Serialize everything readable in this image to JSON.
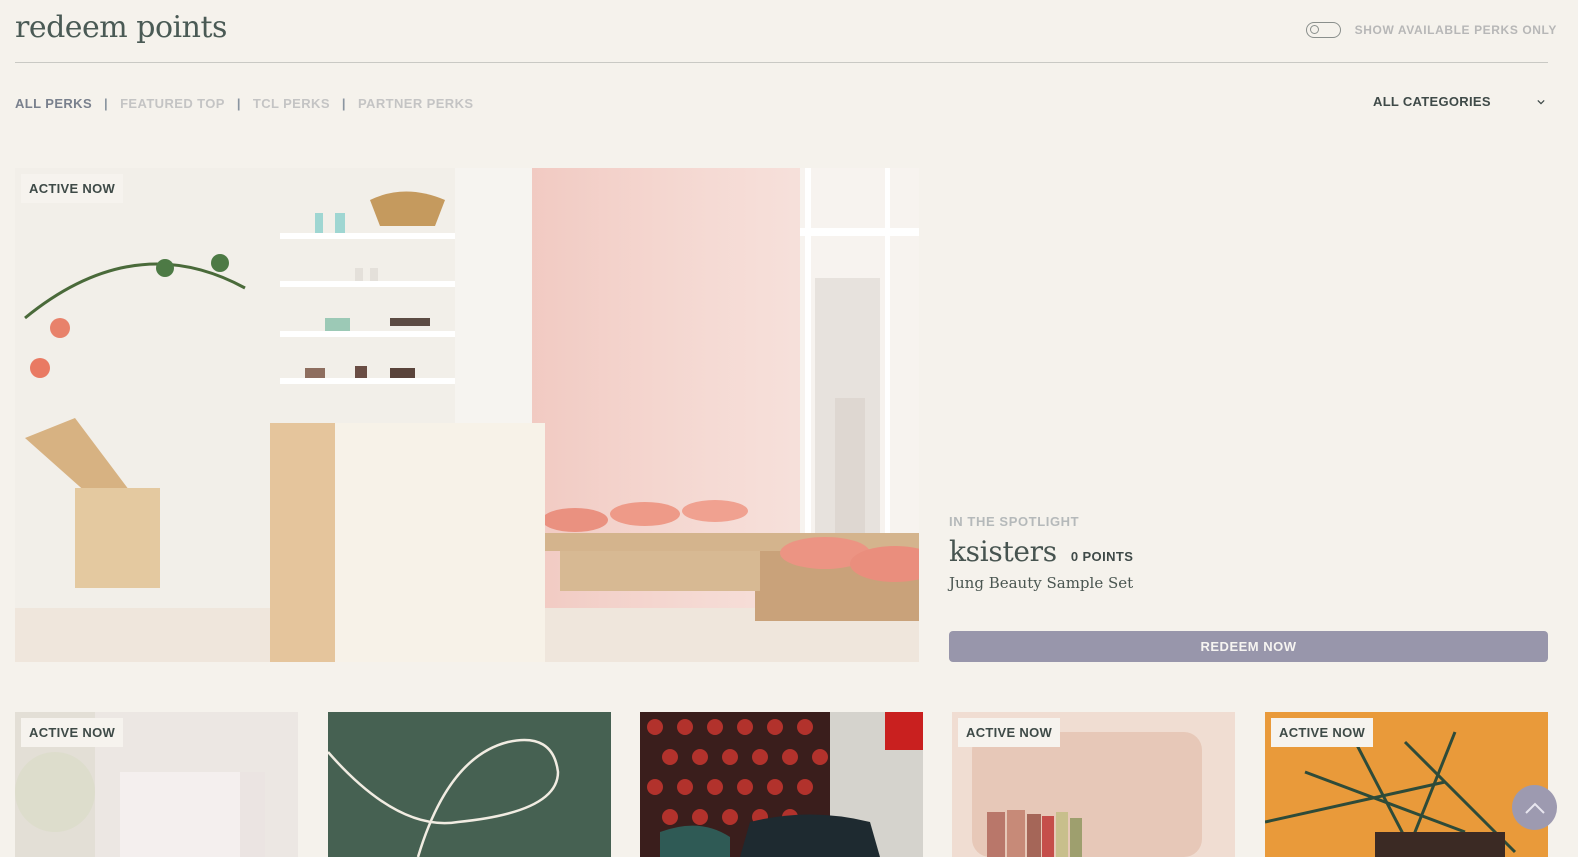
{
  "header": {
    "title": "redeem points",
    "toggle_label": "SHOW AVAILABLE PERKS ONLY"
  },
  "filters": {
    "tabs": [
      {
        "label": "ALL PERKS",
        "active": true
      },
      {
        "label": "FEATURED TOP",
        "active": false
      },
      {
        "label": "TCL PERKS",
        "active": false
      },
      {
        "label": "PARTNER PERKS",
        "active": false
      }
    ],
    "separator": "|",
    "category_select": "ALL CATEGORIES"
  },
  "spotlight": {
    "badge": "ACTIVE NOW",
    "eyebrow": "IN THE SPOTLIGHT",
    "brand": "ksisters",
    "points": "0 POINTS",
    "product": "Jung Beauty Sample Set",
    "cta": "REDEEM NOW"
  },
  "cards": [
    {
      "badge": "ACTIVE NOW"
    },
    {
      "badge": ""
    },
    {
      "badge": ""
    },
    {
      "badge": "ACTIVE NOW"
    },
    {
      "badge": "ACTIVE NOW"
    }
  ],
  "colors": {
    "background": "#f5f2ec",
    "accent_button": "#9896ab",
    "active_tab": "#79808d",
    "inactive_tab": "#c4c4c4"
  },
  "icons": {
    "dropdown": "chevron-down-icon",
    "scroll_top": "chevron-up-icon"
  }
}
